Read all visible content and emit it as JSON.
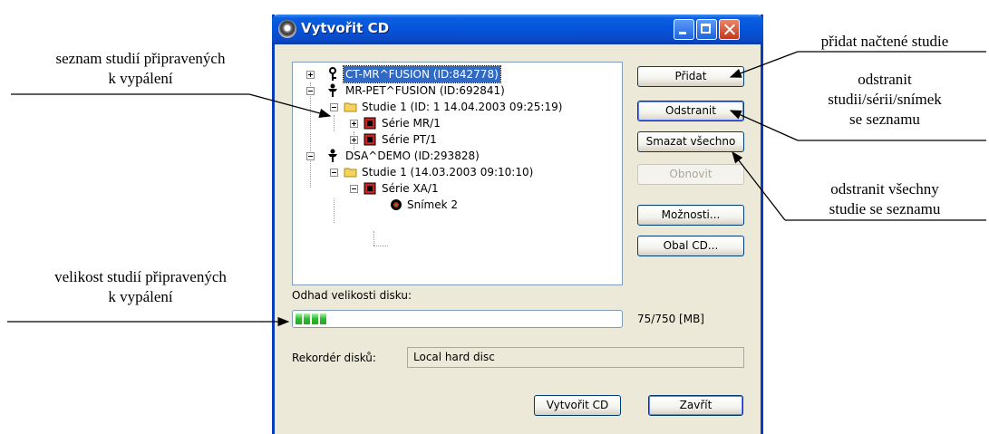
{
  "window": {
    "title": "Vytvořit CD",
    "title_icon": "cd-disc-icon"
  },
  "tree": [
    {
      "label": "CT-MR^FUSION (ID:842778)",
      "icon": "patient-key-icon",
      "expander": "plus",
      "selected": true
    },
    {
      "label": "MR-PET^FUSION (ID:692841)",
      "icon": "patient-icon",
      "expander": "minus"
    },
    {
      "label": "Studie 1 (ID: 1 14.04.2003 09:25:19)",
      "icon": "folder-icon",
      "expander": "minus"
    },
    {
      "label": "Série MR/1",
      "icon": "series-icon",
      "expander": "plus"
    },
    {
      "label": "Série PT/1",
      "icon": "series-icon",
      "expander": "plus"
    },
    {
      "label": "DSA^DEMO (ID:293828)",
      "icon": "patient-icon",
      "expander": "minus"
    },
    {
      "label": "Studie 1 (14.03.2003 09:10:10)",
      "icon": "folder-icon",
      "expander": "minus"
    },
    {
      "label": "Série XA/1",
      "icon": "series-icon",
      "expander": "minus"
    },
    {
      "label": "Snímek 2",
      "icon": "image-icon",
      "expander": "none"
    }
  ],
  "buttons": {
    "add": "Přidat",
    "remove": "Odstranit",
    "clear_all": "Smazat všechno",
    "refresh": "Obnovit",
    "options": "Možnosti...",
    "cd_cover": "Obal CD...",
    "create_cd": "Vytvořit CD",
    "close": "Zavřít"
  },
  "disk": {
    "estimate_label": "Odhad velikosti disku:",
    "used_mb": 75,
    "capacity_mb": 750,
    "size_text": "75/750 [MB]",
    "recorder_label": "Rekordér disků:",
    "recorder_value": "Local hard disc"
  },
  "annotations": {
    "list_line1": "seznam studií připravených",
    "list_line2": "k vypálení",
    "size_line1": "velikost studií připravených",
    "size_line2": "k vypálení",
    "add_note": "přidat načtené studie",
    "remove_line1": "odstranit",
    "remove_line2": "studii/sérii/snímek",
    "remove_line3": "se seznamu",
    "clear_line1": "odstranit všechny",
    "clear_line2": "studie se seznamu"
  },
  "colors": {
    "titlebar": "#0553d8",
    "window_bg": "#ece9d8",
    "selection": "#316ac5",
    "progress_fill": "#2fb82f"
  }
}
